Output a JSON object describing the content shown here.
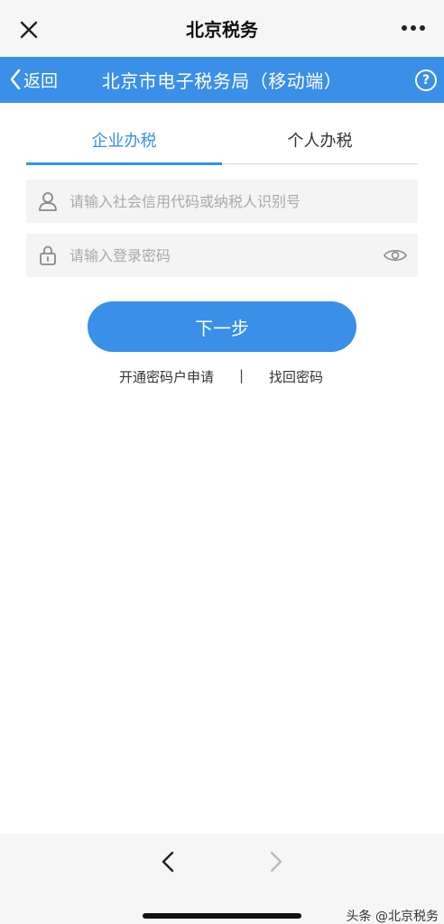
{
  "topbar": {
    "title": "北京税务"
  },
  "header": {
    "back_label": "返回",
    "title": "北京市电子税务局（移动端）",
    "help_label": "?"
  },
  "tabs": [
    {
      "label": "企业办税",
      "active": true
    },
    {
      "label": "个人办税",
      "active": false
    }
  ],
  "form": {
    "account_placeholder": "请输入社会信用代码或纳税人识别号",
    "account_value": "",
    "password_placeholder": "请输入登录密码",
    "password_value": ""
  },
  "next_button": "下一步",
  "links": {
    "apply": "开通密码户申请",
    "separator": "|",
    "recover": "找回密码"
  },
  "watermark": "头条 @北京税务",
  "colors": {
    "accent": "#3a8fe8",
    "field_bg": "#f4f4f4",
    "bar_bg": "#f6f6f6"
  },
  "icons": {
    "close": "close-icon",
    "more": "more-dots-icon",
    "back": "chevron-left-icon",
    "help": "help-icon",
    "user": "user-icon",
    "lock": "lock-icon",
    "eye": "eye-icon",
    "prev": "nav-back-icon",
    "next": "nav-forward-icon"
  }
}
